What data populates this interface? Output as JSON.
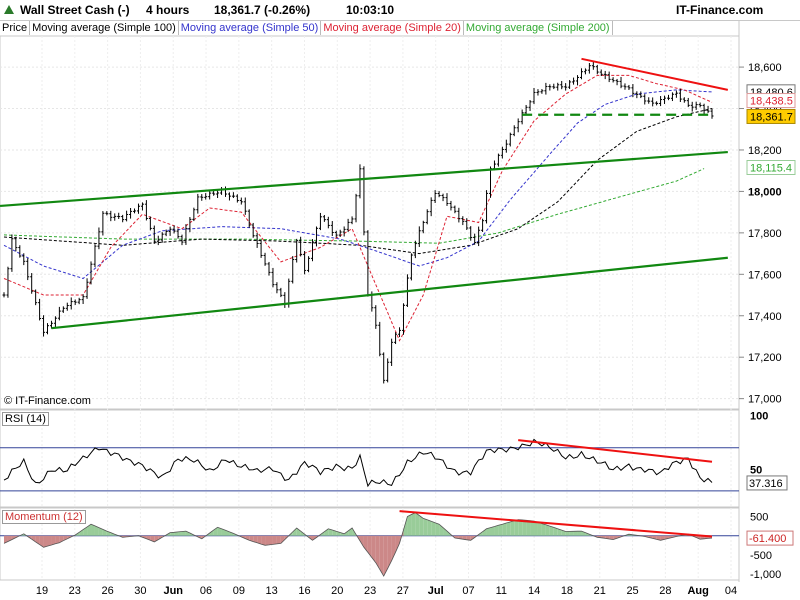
{
  "header": {
    "instrument": "Wall Street Cash (-)",
    "timeframe": "4 hours",
    "last": "18,361.7 (-0.26%)",
    "time": "10:03:10",
    "brand": "IT-Finance.com"
  },
  "legend": {
    "price": "Price",
    "ma100": "Moving average (Simple 100)",
    "ma50": "Moving average (Simple 50)",
    "ma20": "Moving average (Simple 20)",
    "ma200": "Moving average (Simple 200)"
  },
  "watermark": "© IT-Finance.com",
  "colors": {
    "price": "#000000",
    "ma100": "#000000",
    "ma50": "#3333cc",
    "ma20": "#dd2233",
    "ma200": "#33aa33",
    "trend_green": "#118811",
    "trend_red": "#ee1111",
    "rsi_line": "#000000",
    "rsi_band": "#334499",
    "momentum_pos": "#99cc99",
    "momentum_neg": "#cc8888",
    "last_price_tag": "#ffcc00"
  },
  "chart_data": [
    {
      "type": "line",
      "title": "Wall Street Cash (-)",
      "ylim": [
        16950,
        18750
      ],
      "y_ticks": [
        "18,600",
        "18,400",
        "18,200",
        "18,000",
        "17,800",
        "17,600",
        "17,400",
        "17,200",
        "17,000"
      ],
      "y_tick_values": [
        18600,
        18400,
        18200,
        18000,
        17800,
        17600,
        17400,
        17200,
        17000
      ],
      "bold_tick": "18,000",
      "x_ticks": [
        "19",
        "23",
        "26",
        "30",
        "Jun",
        "06",
        "09",
        "13",
        "16",
        "20",
        "23",
        "27",
        "Jul",
        "07",
        "11",
        "14",
        "18",
        "21",
        "25",
        "28",
        "Aug",
        "04"
      ],
      "bold_x_ticks": [
        "Jun",
        "Jul",
        "Aug"
      ],
      "n_bars": 180,
      "price_knots": [
        [
          0,
          17500
        ],
        [
          2,
          17760
        ],
        [
          5,
          17650
        ],
        [
          10,
          17330
        ],
        [
          15,
          17440
        ],
        [
          20,
          17480
        ],
        [
          25,
          17900
        ],
        [
          30,
          17870
        ],
        [
          35,
          17930
        ],
        [
          38,
          17760
        ],
        [
          42,
          17830
        ],
        [
          45,
          17760
        ],
        [
          49,
          17960
        ],
        [
          55,
          18010
        ],
        [
          60,
          17950
        ],
        [
          63,
          17780
        ],
        [
          68,
          17560
        ],
        [
          71,
          17470
        ],
        [
          74,
          17770
        ],
        [
          76,
          17610
        ],
        [
          80,
          17880
        ],
        [
          84,
          17790
        ],
        [
          88,
          17870
        ],
        [
          90,
          18100
        ],
        [
          92,
          17500
        ],
        [
          94,
          17350
        ],
        [
          96,
          17080
        ],
        [
          98,
          17280
        ],
        [
          100,
          17340
        ],
        [
          103,
          17700
        ],
        [
          106,
          17850
        ],
        [
          109,
          17990
        ],
        [
          112,
          17950
        ],
        [
          116,
          17860
        ],
        [
          119,
          17750
        ],
        [
          121,
          17860
        ],
        [
          123,
          18100
        ],
        [
          126,
          18200
        ],
        [
          130,
          18350
        ],
        [
          134,
          18470
        ],
        [
          138,
          18500
        ],
        [
          142,
          18510
        ],
        [
          145,
          18560
        ],
        [
          148,
          18610
        ],
        [
          151,
          18560
        ],
        [
          154,
          18530
        ],
        [
          158,
          18500
        ],
        [
          161,
          18460
        ],
        [
          164,
          18420
        ],
        [
          167,
          18440
        ],
        [
          170,
          18470
        ],
        [
          173,
          18420
        ],
        [
          176,
          18420
        ],
        [
          179,
          18362
        ]
      ],
      "ma20_knots": [
        [
          0,
          17580
        ],
        [
          10,
          17500
        ],
        [
          20,
          17500
        ],
        [
          27,
          17730
        ],
        [
          35,
          17890
        ],
        [
          45,
          17820
        ],
        [
          52,
          17920
        ],
        [
          60,
          17900
        ],
        [
          70,
          17660
        ],
        [
          80,
          17730
        ],
        [
          88,
          17820
        ],
        [
          94,
          17550
        ],
        [
          100,
          17280
        ],
        [
          106,
          17500
        ],
        [
          112,
          17880
        ],
        [
          120,
          17850
        ],
        [
          126,
          18100
        ],
        [
          134,
          18340
        ],
        [
          142,
          18470
        ],
        [
          150,
          18560
        ],
        [
          158,
          18560
        ],
        [
          165,
          18520
        ],
        [
          172,
          18490
        ],
        [
          179,
          18430
        ]
      ],
      "ma50_knots": [
        [
          0,
          17740
        ],
        [
          10,
          17640
        ],
        [
          20,
          17580
        ],
        [
          30,
          17740
        ],
        [
          40,
          17810
        ],
        [
          55,
          17830
        ],
        [
          70,
          17820
        ],
        [
          85,
          17770
        ],
        [
          96,
          17700
        ],
        [
          105,
          17640
        ],
        [
          112,
          17680
        ],
        [
          120,
          17760
        ],
        [
          128,
          17960
        ],
        [
          138,
          18180
        ],
        [
          145,
          18330
        ],
        [
          152,
          18420
        ],
        [
          160,
          18470
        ],
        [
          170,
          18490
        ],
        [
          179,
          18480
        ]
      ],
      "ma100_knots": [
        [
          0,
          17780
        ],
        [
          15,
          17760
        ],
        [
          30,
          17740
        ],
        [
          50,
          17770
        ],
        [
          70,
          17760
        ],
        [
          90,
          17740
        ],
        [
          105,
          17700
        ],
        [
          118,
          17740
        ],
        [
          130,
          17820
        ],
        [
          140,
          17950
        ],
        [
          150,
          18150
        ],
        [
          160,
          18290
        ],
        [
          170,
          18360
        ],
        [
          179,
          18400
        ]
      ],
      "ma200_knots": [
        [
          0,
          17790
        ],
        [
          30,
          17770
        ],
        [
          60,
          17770
        ],
        [
          90,
          17760
        ],
        [
          110,
          17750
        ],
        [
          125,
          17800
        ],
        [
          140,
          17890
        ],
        [
          155,
          17970
        ],
        [
          170,
          18050
        ],
        [
          177,
          18110
        ]
      ],
      "trend_green_upper": [
        [
          -1,
          17930
        ],
        [
          183,
          18190
        ]
      ],
      "trend_green_lower": [
        [
          12,
          17340
        ],
        [
          183,
          17680
        ]
      ],
      "trend_red": [
        [
          146,
          18640
        ],
        [
          183,
          18490
        ]
      ],
      "dashed_support": [
        [
          131,
          18370
        ],
        [
          179,
          18370
        ]
      ],
      "value_tags": [
        {
          "label": "18,480.6",
          "value": 18480.6
        },
        {
          "label": "18,438.5",
          "value": 18438.5
        },
        {
          "label": "18,361.7",
          "value": 18361.7
        },
        {
          "label": "18,115.4",
          "value": 18115.4
        }
      ]
    },
    {
      "type": "line",
      "title": "RSI (14)",
      "ylim": [
        15,
        105
      ],
      "y_ticks": [
        "100",
        "50"
      ],
      "y_tick_values": [
        100,
        50
      ],
      "bands": [
        70,
        30
      ],
      "last_label": "37.316",
      "last_value": 37.316,
      "rsi_knots": [
        [
          0,
          40
        ],
        [
          5,
          55
        ],
        [
          8,
          36
        ],
        [
          12,
          52
        ],
        [
          16,
          48
        ],
        [
          20,
          58
        ],
        [
          24,
          72
        ],
        [
          28,
          66
        ],
        [
          32,
          55
        ],
        [
          36,
          50
        ],
        [
          40,
          45
        ],
        [
          44,
          60
        ],
        [
          48,
          56
        ],
        [
          52,
          48
        ],
        [
          56,
          62
        ],
        [
          60,
          52
        ],
        [
          64,
          46
        ],
        [
          68,
          52
        ],
        [
          72,
          42
        ],
        [
          76,
          54
        ],
        [
          80,
          46
        ],
        [
          84,
          55
        ],
        [
          88,
          52
        ],
        [
          90,
          60
        ],
        [
          92,
          34
        ],
        [
          95,
          37
        ],
        [
          98,
          38
        ],
        [
          102,
          58
        ],
        [
          106,
          64
        ],
        [
          110,
          58
        ],
        [
          114,
          50
        ],
        [
          118,
          48
        ],
        [
          122,
          64
        ],
        [
          126,
          68
        ],
        [
          130,
          73
        ],
        [
          134,
          75
        ],
        [
          138,
          68
        ],
        [
          142,
          62
        ],
        [
          146,
          66
        ],
        [
          150,
          56
        ],
        [
          154,
          48
        ],
        [
          158,
          55
        ],
        [
          162,
          51
        ],
        [
          166,
          44
        ],
        [
          170,
          56
        ],
        [
          173,
          62
        ],
        [
          176,
          44
        ],
        [
          179,
          37
        ]
      ],
      "trend_red": [
        [
          130,
          77
        ],
        [
          179,
          57
        ]
      ]
    },
    {
      "type": "area",
      "title": "Momentum (12)",
      "ylim": [
        -1150,
        720
      ],
      "y_ticks": [
        "500",
        "0",
        "-500",
        "-1,000"
      ],
      "y_tick_values": [
        500,
        0,
        -500,
        -1000
      ],
      "last_label": "-61.400",
      "last_value": -61.4,
      "momentum_knots": [
        [
          0,
          -200
        ],
        [
          5,
          50
        ],
        [
          10,
          -300
        ],
        [
          14,
          -180
        ],
        [
          18,
          20
        ],
        [
          22,
          300
        ],
        [
          26,
          120
        ],
        [
          30,
          -40
        ],
        [
          34,
          0
        ],
        [
          38,
          -160
        ],
        [
          42,
          80
        ],
        [
          46,
          120
        ],
        [
          50,
          -80
        ],
        [
          54,
          220
        ],
        [
          58,
          60
        ],
        [
          62,
          -120
        ],
        [
          66,
          -250
        ],
        [
          70,
          -200
        ],
        [
          74,
          200
        ],
        [
          78,
          -120
        ],
        [
          82,
          180
        ],
        [
          86,
          50
        ],
        [
          88,
          200
        ],
        [
          91,
          -300
        ],
        [
          94,
          -700
        ],
        [
          96,
          -1050
        ],
        [
          98,
          -650
        ],
        [
          100,
          -200
        ],
        [
          102,
          500
        ],
        [
          104,
          600
        ],
        [
          106,
          450
        ],
        [
          110,
          300
        ],
        [
          114,
          -60
        ],
        [
          118,
          -120
        ],
        [
          122,
          180
        ],
        [
          126,
          300
        ],
        [
          130,
          420
        ],
        [
          134,
          380
        ],
        [
          138,
          250
        ],
        [
          142,
          110
        ],
        [
          146,
          120
        ],
        [
          150,
          -40
        ],
        [
          154,
          -100
        ],
        [
          158,
          40
        ],
        [
          162,
          -20
        ],
        [
          166,
          -120
        ],
        [
          170,
          -20
        ],
        [
          173,
          40
        ],
        [
          176,
          -90
        ],
        [
          179,
          -61
        ]
      ],
      "trend_red": [
        [
          100,
          640
        ],
        [
          179,
          -20
        ]
      ]
    }
  ]
}
